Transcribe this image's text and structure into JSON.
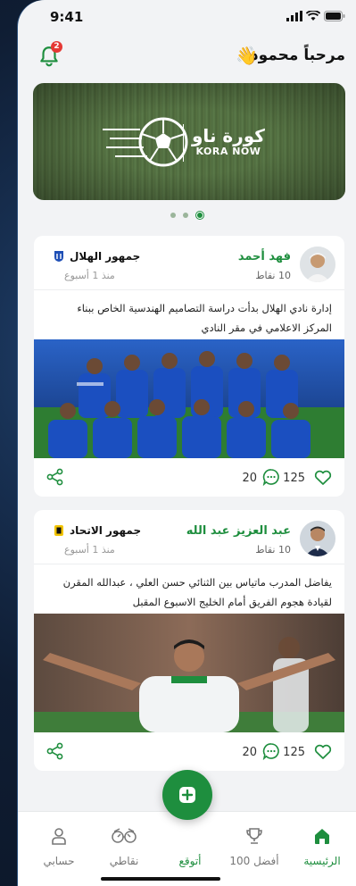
{
  "status_bar": {
    "time": "9:41"
  },
  "header": {
    "greeting": "مرحباً محمود",
    "wave_emoji": "👋",
    "notification_count": "2"
  },
  "banner": {
    "brand_ar": "كورة ناو",
    "brand_en": "KORA NOW",
    "carousel_dots": 3,
    "active_dot": 3
  },
  "posts": [
    {
      "author": "فهد أحمد",
      "points": "10 نقاط",
      "club": "جمهور الهلال",
      "time_ago": "منذ 1 أسبوع",
      "text": "إدارة نادي الهلال بدأت دراسة التصاميم الهندسية الخاص ببناء المركز الاعلامي في مقر النادي",
      "likes": "125",
      "comments": "20"
    },
    {
      "author": "عبد العزيز عبد الله",
      "points": "10 نقاط",
      "club": "جمهور الاتحاد",
      "time_ago": "منذ 1 أسبوع",
      "text": "يفاضل المدرب ماتياس بين الثنائي حسن العلي ، عبدالله المقرن لقيادة هجوم الفريق أمام الخليج الاسبوع المقبل",
      "likes": "125",
      "comments": "20"
    }
  ],
  "tabbar": {
    "home": "الرئيسية",
    "top100": "أفضل 100",
    "predict": "أتوقع",
    "points": "نقاطي",
    "account": "حسابي"
  },
  "colors": {
    "accent": "#1e8e3e",
    "badge": "#e53935",
    "hilal": "#1f4fb6",
    "ittihad": "#f2c400"
  }
}
